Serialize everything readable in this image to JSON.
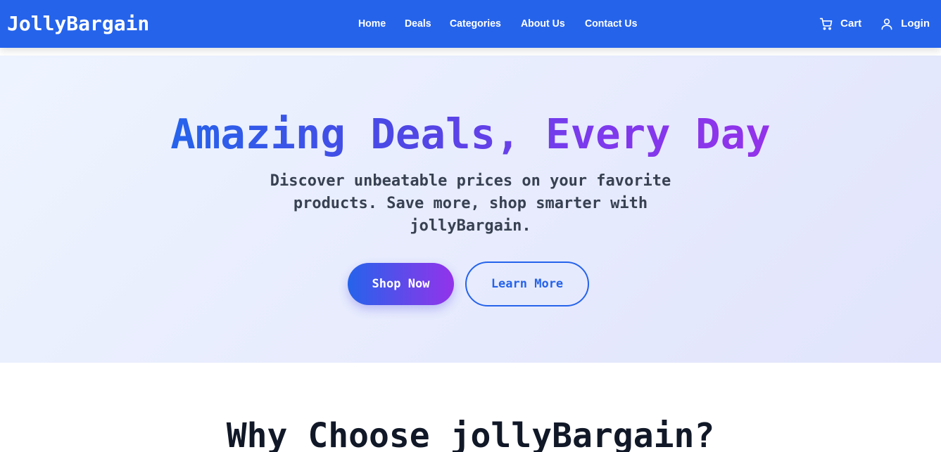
{
  "brand": {
    "name": "JollyBargain"
  },
  "nav": {
    "links": [
      {
        "label": "Home"
      },
      {
        "label": "Deals"
      },
      {
        "label": "Categories"
      },
      {
        "label": "About Us"
      },
      {
        "label": "Contact Us"
      }
    ],
    "cart": {
      "label": "Cart",
      "icon": "cart-icon"
    },
    "login": {
      "label": "Login",
      "icon": "user-icon"
    }
  },
  "hero": {
    "title": "Amazing Deals, Every Day",
    "subtitle": "Discover unbeatable prices on your favorite products. Save more, shop smarter with jollyBargain.",
    "primary_button": "Shop Now",
    "secondary_button": "Learn More"
  },
  "features": {
    "title": "Why Choose jollyBargain?"
  },
  "colors": {
    "nav_background": "#2563eb",
    "gradient_start": "#2563eb",
    "gradient_end": "#9333ea",
    "hero_background": "#e7ebfd",
    "text_dark": "#111827",
    "text_body": "#374151"
  }
}
